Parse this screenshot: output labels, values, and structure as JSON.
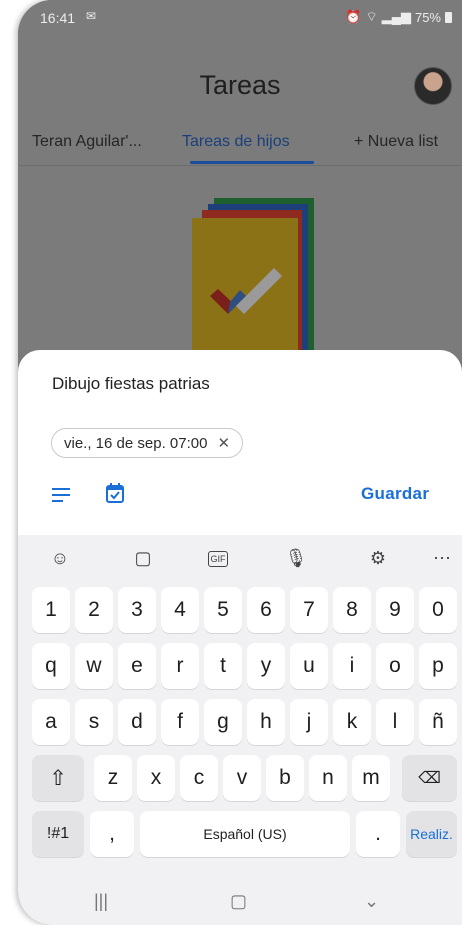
{
  "status": {
    "time": "16:41",
    "battery": "75%"
  },
  "app": {
    "title": "Tareas",
    "tabs": [
      {
        "label": "Teran Aguilar'..."
      },
      {
        "label": "Tareas de hijos"
      },
      {
        "label": "+  Nueva list"
      }
    ]
  },
  "sheet": {
    "task_title": "Dibujo fiestas patrias",
    "date_chip": "vie., 16 de sep. 07:00",
    "save_label": "Guardar"
  },
  "keyboard": {
    "toolbar": [
      "emoji-icon",
      "sticker-icon",
      "gif-icon",
      "microphone-icon",
      "settings-icon",
      "more-icon"
    ],
    "row_numbers": [
      "1",
      "2",
      "3",
      "4",
      "5",
      "6",
      "7",
      "8",
      "9",
      "0"
    ],
    "row_q": [
      "q",
      "w",
      "e",
      "r",
      "t",
      "y",
      "u",
      "i",
      "o",
      "p"
    ],
    "row_a": [
      "a",
      "s",
      "d",
      "f",
      "g",
      "h",
      "j",
      "k",
      "l",
      "ñ"
    ],
    "row_z": [
      "z",
      "x",
      "c",
      "v",
      "b",
      "n",
      "m"
    ],
    "symbols_label": "!#1",
    "comma_label": ",",
    "space_label": "Español (US)",
    "period_label": ".",
    "done_label": "Realiz."
  },
  "colors": {
    "accent": "#1a6fd6",
    "scrim": "#7b7b7b",
    "keyboard_bg": "#f1f1f3"
  }
}
